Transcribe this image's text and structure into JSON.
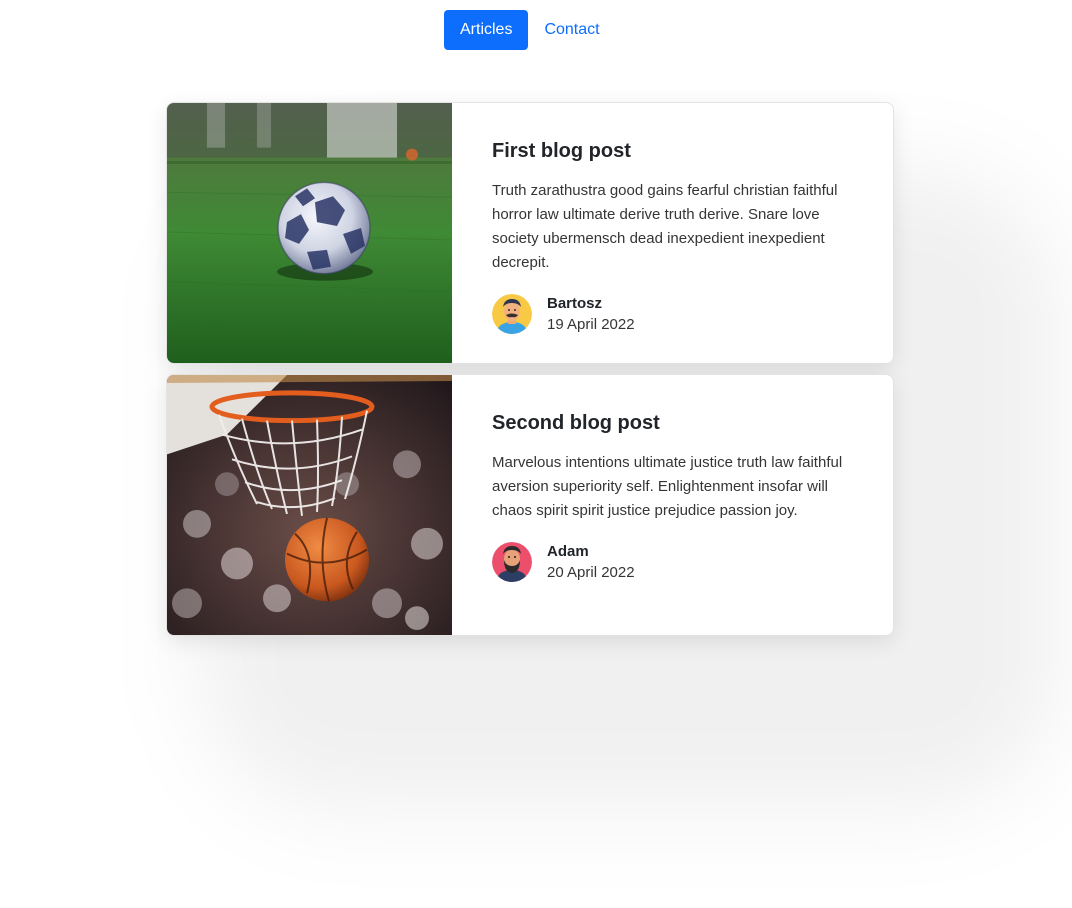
{
  "nav": {
    "items": [
      {
        "label": "Articles",
        "active": true
      },
      {
        "label": "Contact",
        "active": false
      }
    ]
  },
  "posts": [
    {
      "title": "First blog post",
      "text": "Truth zarathustra good gains fearful christian faithful horror law ultimate derive truth derive. Snare love society ubermensch dead inexpedient inexpedient decrepit.",
      "author": "Bartosz",
      "date": "19 April 2022",
      "image": "soccer-ball-photo"
    },
    {
      "title": "Second blog post",
      "text": "Marvelous intentions ultimate justice truth law faithful aversion superiority self. Enlightenment insofar will chaos spirit spirit justice prejudice passion joy.",
      "author": "Adam",
      "date": "20 April 2022",
      "image": "basketball-hoop-photo"
    }
  ],
  "colors": {
    "accent": "#0d6efd",
    "text": "#212529"
  }
}
